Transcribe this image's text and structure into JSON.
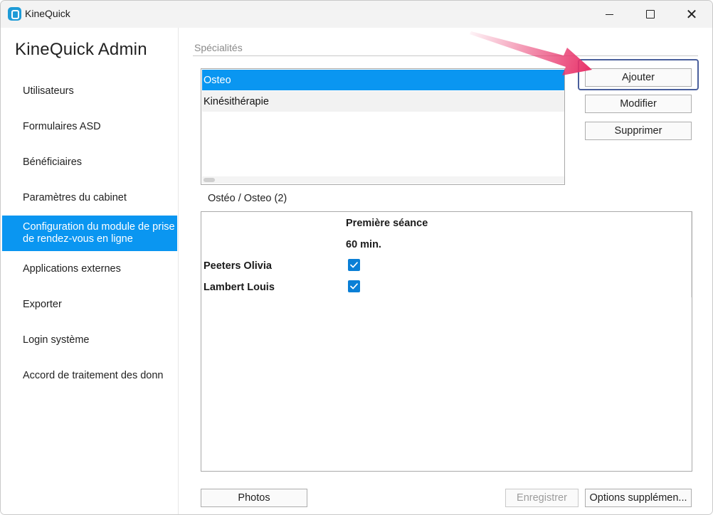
{
  "window": {
    "title": "KineQuick",
    "icon": "kinequick-app-icon",
    "controls": {
      "minimize_icon": "minimize-icon",
      "maximize_icon": "maximize-icon",
      "close_glyph": "✕"
    }
  },
  "sidebar": {
    "title": "KineQuick Admin",
    "items": [
      {
        "label": "Utilisateurs",
        "active": false
      },
      {
        "label": "Formulaires ASD",
        "active": false
      },
      {
        "label": "Bénéficiaires",
        "active": false
      },
      {
        "label": "Paramètres du cabinet",
        "active": false
      },
      {
        "label": "Configuration du module de prise de rendez-vous en ligne",
        "active": true
      },
      {
        "label": "Applications externes",
        "active": false
      },
      {
        "label": "Exporter",
        "active": false
      },
      {
        "label": "Login système",
        "active": false
      },
      {
        "label": "Accord de traitement des donn",
        "active": false
      }
    ]
  },
  "specialities": {
    "section_label": "Spécialités",
    "items": [
      {
        "label": "Osteo",
        "selected": true
      },
      {
        "label": "Kinésithérapie",
        "selected": false
      }
    ],
    "buttons": {
      "add": "Ajouter",
      "edit": "Modifier",
      "delete": "Supprimer"
    }
  },
  "detail": {
    "group_label": "Ostéo / Osteo (2)",
    "column_header": "Première séance",
    "duration": "60 min.",
    "practitioners": [
      {
        "name": "Peeters Olivia",
        "checked": true
      },
      {
        "name": "Lambert Louis",
        "checked": true
      }
    ]
  },
  "footer": {
    "photos": "Photos",
    "save": "Enregistrer",
    "more_options": "Options supplémen..."
  },
  "colors": {
    "accent": "#0a96f1",
    "highlight_border": "#4a5f9c",
    "annotation_arrow": "#e8336a"
  }
}
